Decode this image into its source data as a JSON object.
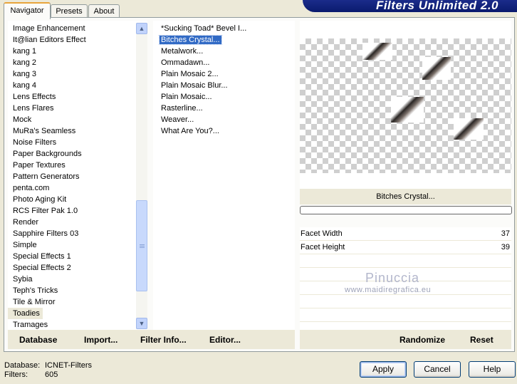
{
  "tabs": [
    {
      "label": "Navigator",
      "active": true
    },
    {
      "label": "Presets",
      "active": false
    },
    {
      "label": "About",
      "active": false
    }
  ],
  "banner": {
    "title": "Filters Unlimited 2.0"
  },
  "categories": {
    "items": [
      "Image Enhancement",
      "It@lian Editors Effect",
      "kang 1",
      "kang 2",
      "kang 3",
      "kang 4",
      "Lens Effects",
      "Lens Flares",
      "Mock",
      "MuRa's Seamless",
      "Noise Filters",
      "Paper Backgrounds",
      "Paper Textures",
      "Pattern Generators",
      "penta.com",
      "Photo Aging Kit",
      "RCS Filter Pak 1.0",
      "Render",
      "Sapphire Filters 03",
      "Simple",
      "Special Effects 1",
      "Special Effects 2",
      "Sybia",
      "Teph's Tricks",
      "Tile & Mirror",
      "Toadies",
      "Tramages"
    ],
    "selected": "Toadies"
  },
  "filters": {
    "items": [
      "*Sucking Toad*  Bevel I...",
      "Bitches Crystal...",
      "Metalwork...",
      "Ommadawn...",
      "Plain Mosaic 2...",
      "Plain Mosaic Blur...",
      "Plain Mosaic...",
      "Rasterline...",
      "Weaver...",
      "What Are You?..."
    ],
    "selected": "Bitches Crystal..."
  },
  "preview": {
    "filter_name": "Bitches Crystal..."
  },
  "params": [
    {
      "label": "Facet Width",
      "value": "37"
    },
    {
      "label": "Facet Height",
      "value": "39"
    }
  ],
  "watermark": {
    "name": "Pinuccia",
    "url": "www.maidiregrafica.eu"
  },
  "actions": {
    "database": "Database",
    "import": "Import...",
    "filter_info": "Filter Info...",
    "editor": "Editor...",
    "randomize": "Randomize",
    "reset": "Reset"
  },
  "status": {
    "database_label": "Database:",
    "database_value": "ICNET-Filters",
    "filters_label": "Filters:",
    "filters_value": "605"
  },
  "buttons": {
    "apply": "Apply",
    "cancel": "Cancel",
    "help": "Help"
  },
  "icons": {
    "scroll_up": "chevron-up-icon",
    "scroll_down": "chevron-down-icon"
  }
}
